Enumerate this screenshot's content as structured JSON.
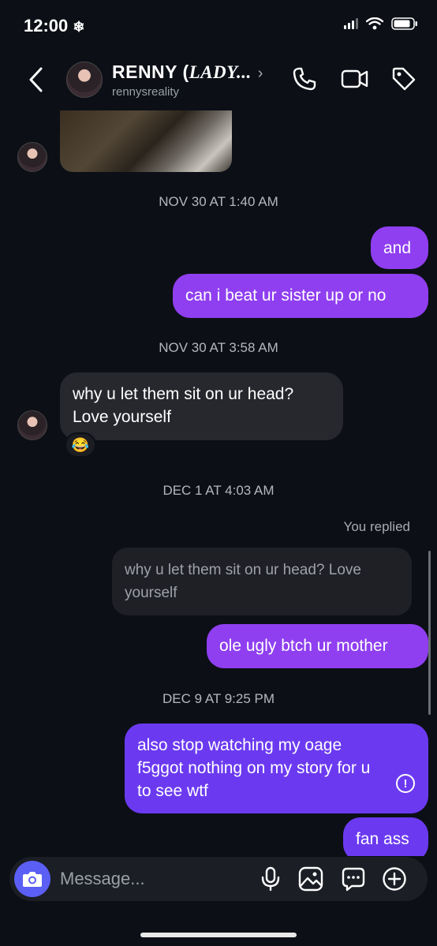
{
  "status_bar": {
    "time": "12:00",
    "snow_glyph": "❄"
  },
  "header": {
    "title_main": "RENNY (",
    "title_italic": "LADY...",
    "title_chevron": "›",
    "username": "rennysreality",
    "icons": [
      "back-chevron-icon",
      "phone-icon",
      "video-camera-icon",
      "tag-icon"
    ]
  },
  "messages": {
    "ts1": "NOV 30 AT 1:40 AM",
    "out1": "and",
    "out2": "can i beat ur sister up or no",
    "ts2": "NOV 30 AT 3:58 AM",
    "in1_line1": "why u let them sit on ur head?",
    "in1_line2": "Love yourself",
    "reaction": "😂",
    "ts3": "DEC 1 AT 4:03 AM",
    "replied_label": "You replied",
    "quoted_line1": "why u let them sit on ur head? Love",
    "quoted_line2": "yourself",
    "out3": "ole ugly btch ur mother",
    "ts4": "DEC 9 AT 9:25 PM",
    "out4_line1": "also stop watching my oage",
    "out4_line2": "f5ggot nothing on my story for u",
    "out4_line3": "to see wtf",
    "error_glyph": "!",
    "out5": "fan ass"
  },
  "composer": {
    "placeholder": "Message...",
    "icons": [
      "camera-icon",
      "microphone-icon",
      "gallery-icon",
      "sticker-icon",
      "plus-icon"
    ]
  },
  "colors": {
    "background": "#0c0f16",
    "outgoing_purple": "#8f3ff0",
    "outgoing_violet": "#6b3af0",
    "incoming": "#26282e",
    "camera_button": "#5b5ff5"
  }
}
